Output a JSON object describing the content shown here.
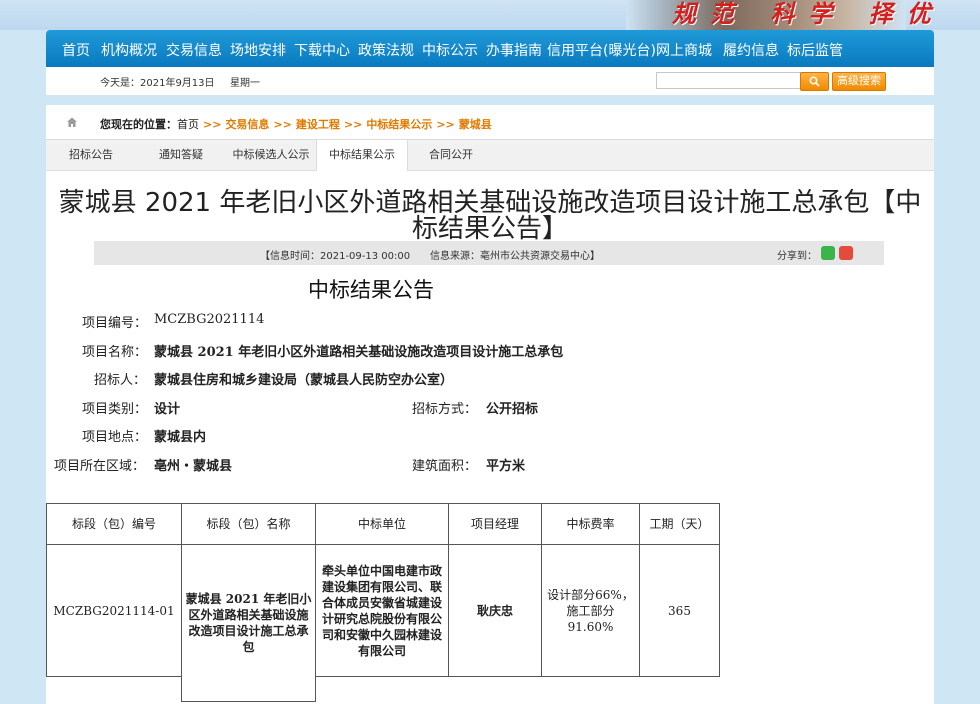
{
  "banner": {
    "slogan": "规范 科学 择优"
  },
  "nav": {
    "items": [
      "首页",
      "机构概况",
      "交易信息",
      "场地安排",
      "下载中心",
      "政策法规",
      "中标公示",
      "办事指南",
      "信用平台(曝光台)",
      "网上商城",
      "履约信息",
      "标后监管"
    ]
  },
  "topbar": {
    "date": "今天是：2021年9月13日",
    "weekday": "星期一",
    "search_placeholder": "",
    "search_icon": "search-icon",
    "advanced_search": "高级搜索"
  },
  "breadcrumb": {
    "label": "您现在的位置：",
    "home": "首页",
    "items": [
      "交易信息",
      "建设工程",
      "中标结果公示",
      "蒙城县"
    ],
    "separator": ">>"
  },
  "tabs": [
    "招标公告",
    "通知答疑",
    "中标候选人公示",
    "中标结果公示",
    "合同公开"
  ],
  "article": {
    "title": "蒙城县 2021 年老旧小区外道路相关基础设施改造项目设计施工总承包【中标结果公告】",
    "info_time": "【信息时间：2021-09-13 00:00",
    "info_source": "信息来源：亳州市公共资源交易中心】",
    "share_label": "分享到：",
    "heading": "中标结果公告"
  },
  "fields": {
    "project_no_label": "项目编号：",
    "project_no": "MCZBG2021114",
    "project_name_label": "项目名称：",
    "project_name": "蒙城县 2021 年老旧小区外道路相关基础设施改造项目设计施工总承包",
    "tenderer_label": "招标人：",
    "tenderer": "蒙城县住房和城乡建设局（蒙城县人民防空办公室）",
    "category_label": "项目类别：",
    "category": "设计",
    "method_label": "招标方式：",
    "method": "公开招标",
    "location_label": "项目地点：",
    "location": "蒙城县内",
    "region_label": "项目所在区域：",
    "region": "亳州・蒙城县",
    "area_label": "建筑面积：",
    "area": "平方米"
  },
  "table": {
    "headers": [
      "标段（包）编号",
      "标段（包）名称",
      "中标单位",
      "项目经理",
      "中标费率",
      "工期（天）"
    ],
    "row": {
      "no": "MCZBG2021114-01",
      "name": "蒙城县 2021 年老旧小区外道路相关基础设施改造项目设计施工总承包",
      "winner": "牵头单位中国电建市政建设集团有限公司、联合体成员安徽省城建设计研究总院股份有限公司和安徽中久园林建设有限公司",
      "manager": "耿庆忠",
      "rate": "设计部分66%，施工部分 91.60%",
      "days": "365"
    }
  }
}
